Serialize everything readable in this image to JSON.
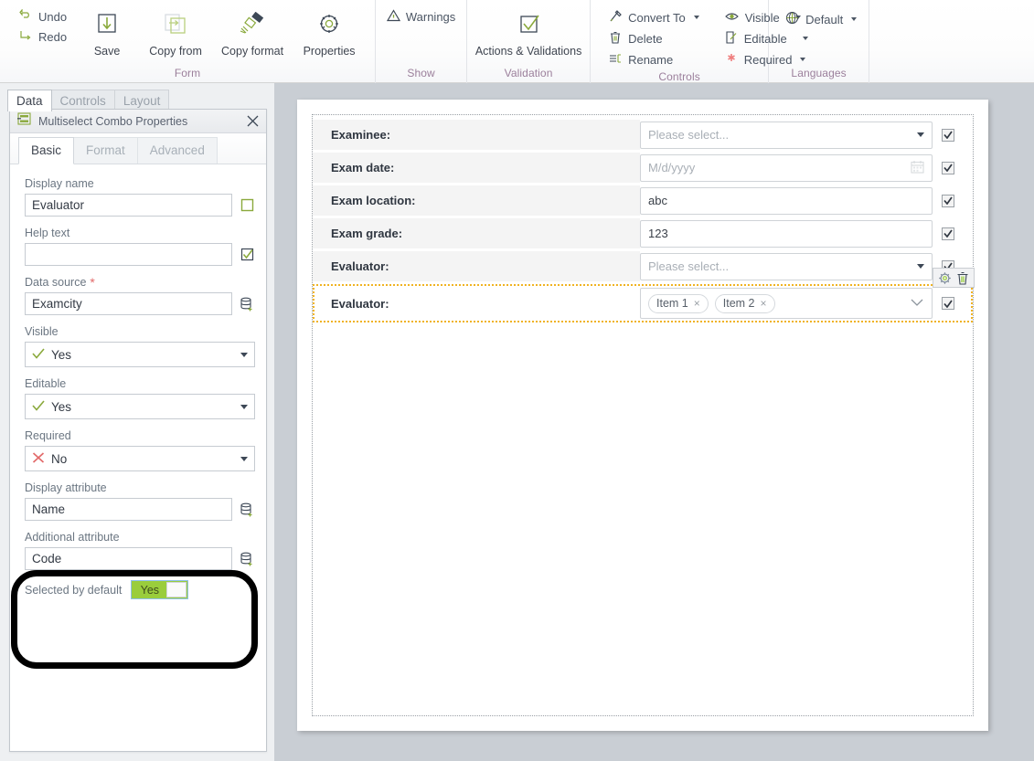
{
  "ribbon": {
    "quick": [
      {
        "label": "Undo",
        "icon": "undo-icon"
      },
      {
        "label": "Redo",
        "icon": "redo-icon"
      }
    ],
    "groups": [
      {
        "title": "Form",
        "buttons": [
          {
            "label": "Save",
            "icon": "save-icon"
          },
          {
            "label": "Copy from",
            "icon": "copy-from-icon"
          },
          {
            "label": "Copy format",
            "icon": "copy-format-icon"
          },
          {
            "label": "Properties",
            "icon": "gear-icon"
          }
        ]
      },
      {
        "title": "Show",
        "buttons": [
          {
            "label": "Warnings",
            "icon": "warning-icon"
          }
        ]
      },
      {
        "title": "Validation",
        "buttons": [
          {
            "label": "Actions & Validations",
            "icon": "checkbox-check-icon"
          }
        ]
      },
      {
        "title": "Controls",
        "rows": [
          {
            "label": "Convert To",
            "icon": "convert-icon",
            "caret": true
          },
          {
            "label": "Delete",
            "icon": "trash-icon",
            "caret": false
          },
          {
            "label": "Rename",
            "icon": "rename-icon",
            "caret": false
          },
          {
            "label": "Visible",
            "icon": "eye-icon",
            "caret": true
          },
          {
            "label": "Editable",
            "icon": "pencil-page-icon",
            "caret": true
          },
          {
            "label": "Required",
            "icon": "asterisk-icon",
            "caret": true
          }
        ]
      },
      {
        "title": "Languages",
        "rows": [
          {
            "label": "Default",
            "icon": "globe-icon",
            "caret": true
          }
        ]
      }
    ]
  },
  "left_panel": {
    "tabs": [
      {
        "label": "Data",
        "active": true
      },
      {
        "label": "Controls",
        "active": false
      },
      {
        "label": "Layout",
        "active": false
      }
    ],
    "window_title": "Multiselect Combo Properties",
    "window_icon": "multiselect-combo-icon",
    "close_icon": "close-icon",
    "subtabs": [
      {
        "label": "Basic",
        "active": true
      },
      {
        "label": "Format",
        "active": false
      },
      {
        "label": "Advanced",
        "active": false
      }
    ],
    "fields": {
      "display_name": {
        "label": "Display name",
        "value": "Evaluator",
        "side_icon": "empty-checkbox-icon"
      },
      "help_text": {
        "label": "Help text",
        "value": "",
        "side_icon": "checked-checkbox-icon"
      },
      "data_source": {
        "label": "Data source",
        "required_mark": "*",
        "value": "Examcity",
        "side_icon": "database-add-icon"
      },
      "visible": {
        "label": "Visible",
        "value": "Yes",
        "state_icon": "check-icon"
      },
      "editable": {
        "label": "Editable",
        "value": "Yes",
        "state_icon": "check-icon"
      },
      "required": {
        "label": "Required",
        "value": "No",
        "state_icon": "cross-icon"
      },
      "display_attribute": {
        "label": "Display attribute",
        "value": "Name",
        "side_icon": "database-add-icon"
      },
      "additional_attribute": {
        "label": "Additional attribute",
        "value": "Code",
        "side_icon": "database-add-icon"
      },
      "selected_by_default": {
        "label": "Selected by default",
        "value": "Yes"
      }
    }
  },
  "form_canvas": {
    "rows": [
      {
        "label": "Examinee:",
        "type": "select",
        "placeholder": "Please select...",
        "value": "",
        "checked": true
      },
      {
        "label": "Exam date:",
        "type": "date",
        "placeholder": "M/d/yyyy",
        "value": "",
        "checked": true,
        "icon": "calendar-icon"
      },
      {
        "label": "Exam location:",
        "type": "text",
        "placeholder": "",
        "value": "abc",
        "checked": true
      },
      {
        "label": "Exam grade:",
        "type": "text",
        "placeholder": "",
        "value": "123",
        "checked": true
      },
      {
        "label": "Evaluator:",
        "type": "select",
        "placeholder": "Please select...",
        "value": "",
        "checked": true
      },
      {
        "label": "Evaluator:",
        "type": "multiselect",
        "tags": [
          "Item 1",
          "Item 2"
        ],
        "checked": true,
        "selected": true
      }
    ],
    "selected_tools": [
      {
        "icon": "gear-icon",
        "name": "settings"
      },
      {
        "icon": "trash-icon",
        "name": "delete"
      }
    ],
    "tag_remove_glyph": "×"
  },
  "colors": {
    "accent_green": "#9acd3c",
    "selection_orange": "#f0b323",
    "group_title": "#9b7f9b",
    "required_red": "#e26a6a",
    "annotation": "#000000"
  }
}
